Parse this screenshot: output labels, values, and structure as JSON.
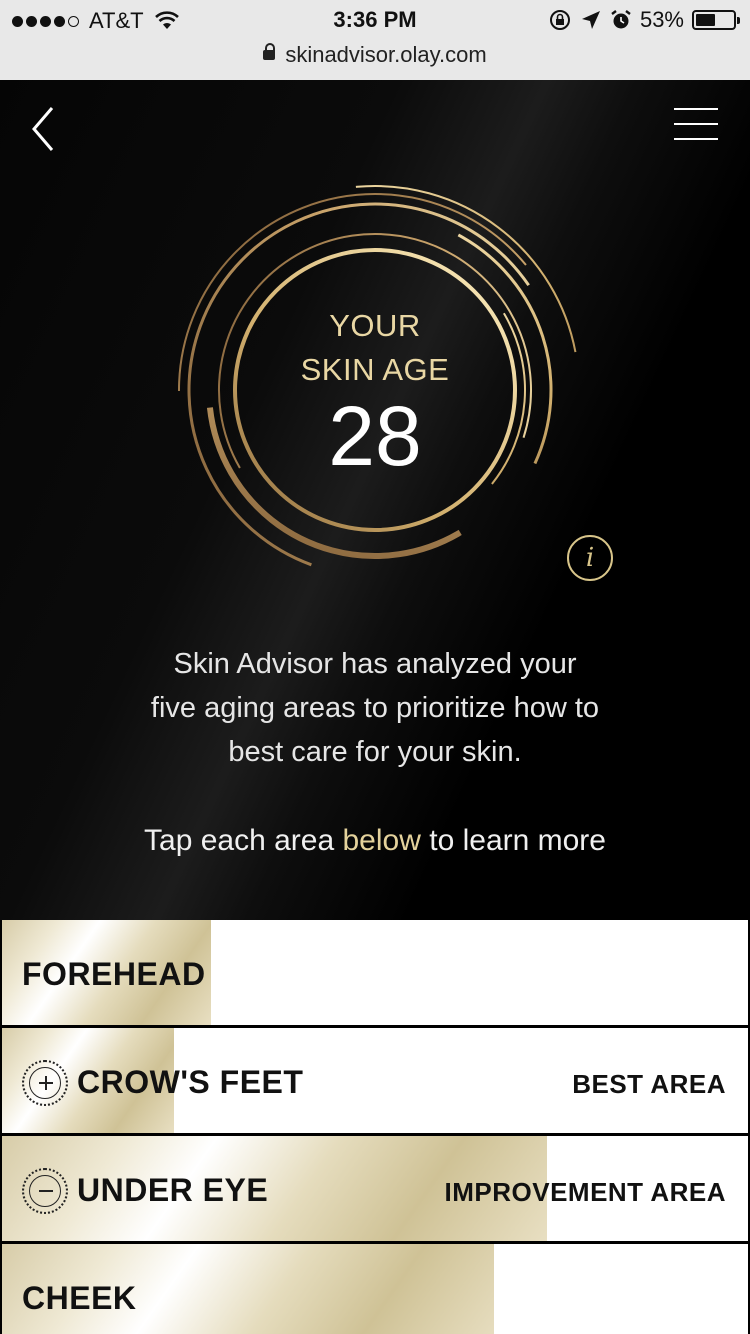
{
  "status_bar": {
    "carrier": "AT&T",
    "time": "3:36 PM",
    "battery": "53%",
    "battery_level": 0.53,
    "icons": [
      "signal-dots-icon",
      "wifi-icon",
      "orientation-lock-icon",
      "location-icon",
      "alarm-icon",
      "battery-icon"
    ]
  },
  "url_bar": {
    "domain": "skinadvisor.olay.com",
    "icon": "lock-icon"
  },
  "nav": {
    "back_icon": "chevron-left-icon",
    "menu_icon": "hamburger-menu-icon"
  },
  "skin_age": {
    "label_line1": "YOUR",
    "label_line2": "SKIN AGE",
    "value": "28",
    "info_label": "i"
  },
  "description": {
    "line1": "Skin Advisor has analyzed your",
    "line2": "five aging areas to prioritize how to",
    "line3": "best care for your skin.",
    "tap_before": "Tap each area",
    "tap_highlight": "below",
    "tap_after": "to learn more"
  },
  "colors": {
    "gold": "#e9d7a4",
    "accent_highlight": "#e4d29c",
    "background": "#000000"
  },
  "areas": [
    {
      "name": "FOREHEAD",
      "tag": "",
      "icon": "",
      "score": 0.28
    },
    {
      "name": "CROW'S FEET",
      "tag": "BEST AREA",
      "icon": "plus-circle-icon",
      "score": 0.23
    },
    {
      "name": "UNDER EYE",
      "tag": "IMPROVEMENT AREA",
      "icon": "minus-circle-icon",
      "score": 0.73
    },
    {
      "name": "CHEEK",
      "tag": "",
      "icon": "",
      "score": 0.66
    }
  ]
}
